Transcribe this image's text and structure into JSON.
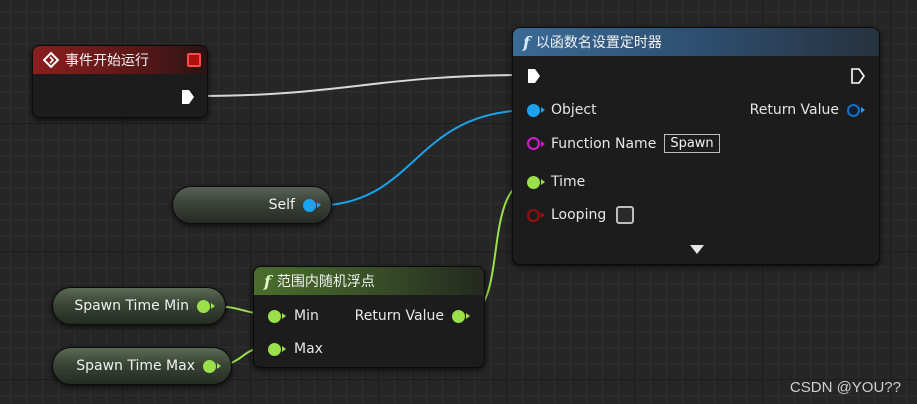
{
  "colors": {
    "exec_wire": "#e0e0e0",
    "object_wire": "#1aa3ee",
    "float_wire": "#9ae04a",
    "event_header": "#8a1f1f",
    "function_header": "#3a6a96",
    "pure_function_header": "#4a6e2c"
  },
  "event_node": {
    "title": "事件开始运行",
    "icon": "diamond-event-icon",
    "close_icon": "red-square-icon"
  },
  "timer_node": {
    "title": "以函数名设置定时器",
    "icon": "f-function-icon",
    "object_label": "Object",
    "return_label": "Return Value",
    "function_name_label": "Function Name",
    "function_name_value": "Spawn",
    "time_label": "Time",
    "looping_label": "Looping",
    "looping_checked": false,
    "expand_icon": "down-triangle-icon"
  },
  "self_node": {
    "label": "Self"
  },
  "random_node": {
    "title": "范围内随机浮点",
    "icon": "f-function-icon",
    "min_label": "Min",
    "max_label": "Max",
    "return_label": "Return Value"
  },
  "spawn_min_node": {
    "label": "Spawn Time Min"
  },
  "spawn_max_node": {
    "label": "Spawn Time Max"
  },
  "watermark": "CSDN @YOU??"
}
